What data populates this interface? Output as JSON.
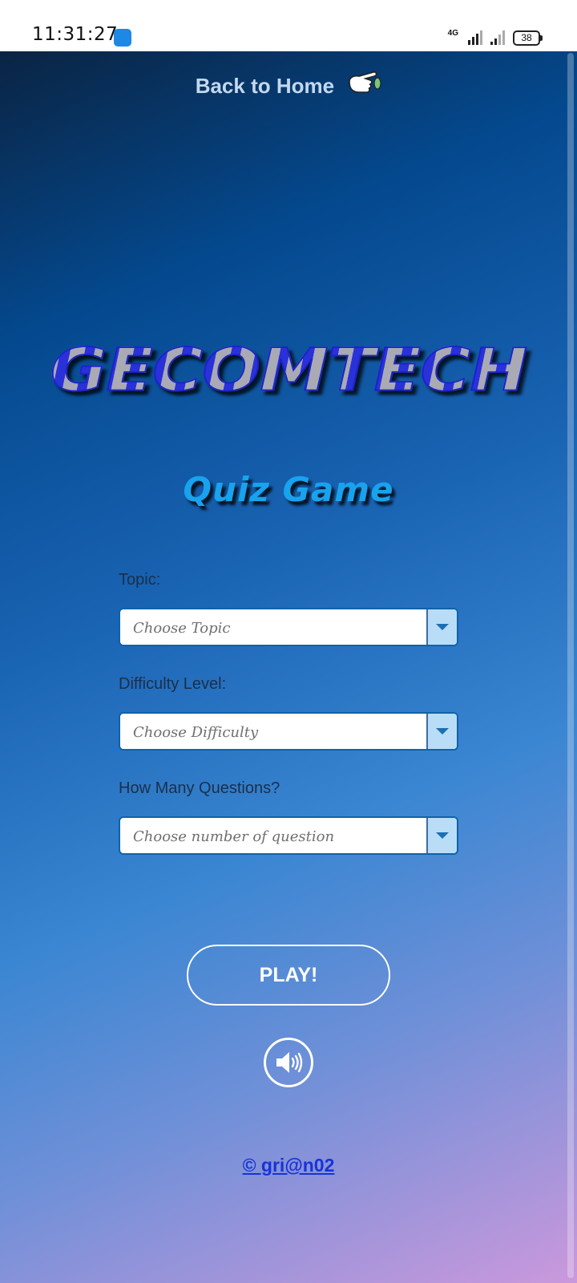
{
  "status_bar": {
    "time": "11:31:27",
    "network_label": "4G",
    "battery": "38"
  },
  "app": {
    "back_link": "Back to Home",
    "logo_title": "GECOMTECH",
    "subtitle": "Quiz Game",
    "form": {
      "topic": {
        "label": "Topic:",
        "value": "Choose Topic"
      },
      "difficulty": {
        "label": "Difficulty Level:",
        "value": "Choose Difficulty"
      },
      "questions": {
        "label": "How Many Questions?",
        "value": "Choose number of question"
      }
    },
    "play_label": "PLAY!",
    "credit": "© gri@n02"
  },
  "icons": {
    "app_notification": "android-icon",
    "back": "pointing-hand-icon",
    "sound": "speaker-volume-icon",
    "dropdown": "chevron-down-icon"
  },
  "colors": {
    "gradient_top": "#0a2443",
    "gradient_mid": "#3a86d2",
    "gradient_bottom": "#cb98dc",
    "logo_blue": "#2a31d8",
    "subtitle": "#19a2ee",
    "credit": "#1634d8"
  }
}
